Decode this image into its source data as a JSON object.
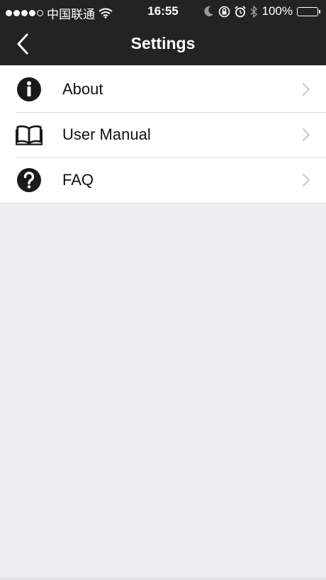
{
  "status_bar": {
    "carrier": "中国联通",
    "time": "16:55",
    "battery": "100%",
    "signal_strength": 4,
    "signal_max": 5
  },
  "nav": {
    "title": "Settings",
    "back_icon": "chevron-left-icon"
  },
  "menu": [
    {
      "label": "About",
      "icon": "info-icon"
    },
    {
      "label": "User Manual",
      "icon": "book-icon"
    },
    {
      "label": "FAQ",
      "icon": "question-icon"
    }
  ],
  "colors": {
    "navbar_bg": "#232323",
    "page_bg": "#efeff4",
    "row_bg": "#ffffff",
    "chevron": "#c7c7cc"
  }
}
